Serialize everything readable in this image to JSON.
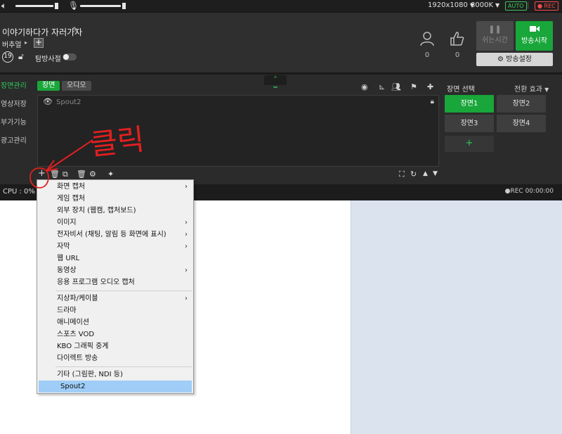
{
  "topbar": {
    "resolution": "1920x1080",
    "bitrate": "8000K",
    "auto_badge": "AUTO",
    "rec_badge": "REC"
  },
  "broadcast": {
    "title": "이야기하다가 자러가자",
    "category": "버추얼",
    "age_badge": "19",
    "explore_label": "탐방사절",
    "viewers": "0",
    "likes": "0",
    "rest_label": "쉬는시간",
    "live_label": "방송시작",
    "settings_label": "방송설정"
  },
  "leftnav": [
    {
      "label": "장면관리"
    },
    {
      "label": "영상저장"
    },
    {
      "label": "부가기능"
    },
    {
      "label": "광고관리"
    }
  ],
  "tabs": {
    "scene": "장면",
    "audio": "오디오"
  },
  "source": {
    "name": "Spout2"
  },
  "scene_panel": {
    "title": "장면 선택",
    "transition": "전환 효과",
    "scenes": [
      "장면1",
      "장면2",
      "장면3",
      "장면4"
    ],
    "add": "+"
  },
  "status": {
    "cpu": "CPU : 0%",
    "rec": "●REC 00:00:00"
  },
  "menu": {
    "items": [
      {
        "label": "화면 캡처",
        "sub": "›"
      },
      {
        "label": "게임 캡처",
        "sub": ""
      },
      {
        "label": "외부 장치 (웹캠, 캡처보드)",
        "sub": ""
      },
      {
        "label": "이미지",
        "sub": "›"
      },
      {
        "label": "전자비서 (채팅, 알림 등 화면에 표시)",
        "sub": "›"
      },
      {
        "label": "자막",
        "sub": "›"
      },
      {
        "label": "웹 URL",
        "sub": ""
      },
      {
        "label": "동영상",
        "sub": "›"
      },
      {
        "label": "응용 프로그램 오디오 캡처",
        "sub": ""
      },
      {
        "label": "지상파/케이블",
        "sub": "›"
      },
      {
        "label": "드라마",
        "sub": ""
      },
      {
        "label": "애니메이션",
        "sub": ""
      },
      {
        "label": "스포츠 VOD",
        "sub": ""
      },
      {
        "label": "KBO 그래픽 중계",
        "sub": ""
      },
      {
        "label": "다이렉트 방송",
        "sub": ""
      },
      {
        "label": "기타 (그림판, NDI 등)",
        "sub": ""
      },
      {
        "label": "Spout2",
        "sub": ""
      }
    ]
  },
  "annotation": {
    "text": "클릭"
  },
  "colors": {
    "accent_green": "#19a63a",
    "annotation_red": "#e02020",
    "menu_highlight": "#9fcdf7"
  }
}
